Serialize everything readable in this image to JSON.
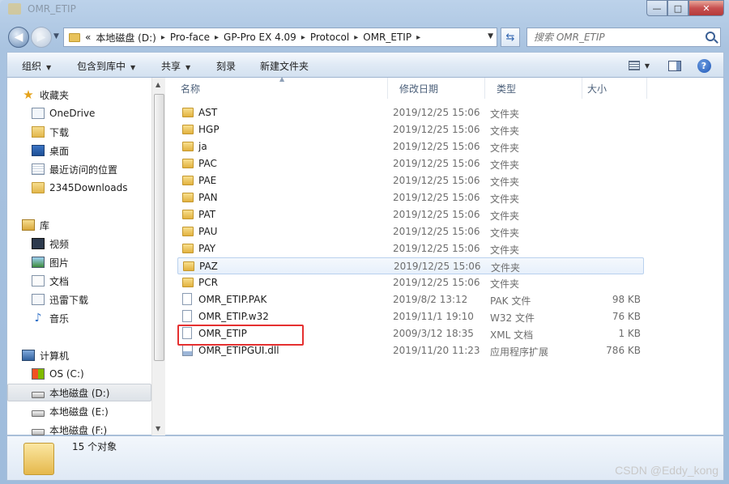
{
  "window": {
    "title": "OMR_ETIP",
    "buttons": {
      "minimize": "—",
      "maximize": "□",
      "close": "✕"
    }
  },
  "address": {
    "prefix": "«",
    "crumbs": [
      "本地磁盘 (D:)",
      "Pro-face",
      "GP-Pro EX 4.09",
      "Protocol",
      "OMR_ETIP"
    ],
    "separator": "▸"
  },
  "search": {
    "placeholder": "搜索 OMR_ETIP"
  },
  "toolbar": {
    "organize": "组织",
    "include_in_library": "包含到库中",
    "share": "共享",
    "burn": "刻录",
    "new_folder": "新建文件夹"
  },
  "navpane": {
    "favorites": {
      "header": "收藏夹",
      "items": [
        "OneDrive",
        "下载",
        "桌面",
        "最近访问的位置",
        "2345Downloads"
      ]
    },
    "libraries": {
      "header": "库",
      "items": [
        "视频",
        "图片",
        "文档",
        "迅雷下载",
        "音乐"
      ]
    },
    "computer": {
      "header": "计算机",
      "items": [
        "OS (C:)",
        "本地磁盘 (D:)",
        "本地磁盘 (E:)",
        "本地磁盘 (F:)"
      ],
      "selected": "本地磁盘 (D:)"
    }
  },
  "columns": {
    "name": "名称",
    "modified": "修改日期",
    "type": "类型",
    "size": "大小"
  },
  "files": [
    {
      "name": "AST",
      "modified": "2019/12/25 15:06",
      "type": "文件夹",
      "size": "",
      "kind": "folder"
    },
    {
      "name": "HGP",
      "modified": "2019/12/25 15:06",
      "type": "文件夹",
      "size": "",
      "kind": "folder"
    },
    {
      "name": "ja",
      "modified": "2019/12/25 15:06",
      "type": "文件夹",
      "size": "",
      "kind": "folder"
    },
    {
      "name": "PAC",
      "modified": "2019/12/25 15:06",
      "type": "文件夹",
      "size": "",
      "kind": "folder"
    },
    {
      "name": "PAE",
      "modified": "2019/12/25 15:06",
      "type": "文件夹",
      "size": "",
      "kind": "folder"
    },
    {
      "name": "PAN",
      "modified": "2019/12/25 15:06",
      "type": "文件夹",
      "size": "",
      "kind": "folder"
    },
    {
      "name": "PAT",
      "modified": "2019/12/25 15:06",
      "type": "文件夹",
      "size": "",
      "kind": "folder"
    },
    {
      "name": "PAU",
      "modified": "2019/12/25 15:06",
      "type": "文件夹",
      "size": "",
      "kind": "folder"
    },
    {
      "name": "PAY",
      "modified": "2019/12/25 15:06",
      "type": "文件夹",
      "size": "",
      "kind": "folder"
    },
    {
      "name": "PAZ",
      "modified": "2019/12/25 15:06",
      "type": "文件夹",
      "size": "",
      "kind": "folder"
    },
    {
      "name": "PCR",
      "modified": "2019/12/25 15:06",
      "type": "文件夹",
      "size": "",
      "kind": "folder"
    },
    {
      "name": "OMR_ETIP.PAK",
      "modified": "2019/8/2 13:12",
      "type": "PAK 文件",
      "size": "98 KB",
      "kind": "file"
    },
    {
      "name": "OMR_ETIP.w32",
      "modified": "2019/11/1 19:10",
      "type": "W32 文件",
      "size": "76 KB",
      "kind": "file"
    },
    {
      "name": "OMR_ETIP",
      "modified": "2009/3/12 18:35",
      "type": "XML 文档",
      "size": "1 KB",
      "kind": "file"
    },
    {
      "name": "OMR_ETIPGUI.dll",
      "modified": "2019/11/20 11:23",
      "type": "应用程序扩展",
      "size": "786 KB",
      "kind": "dll"
    }
  ],
  "hovered_row": "PAZ",
  "highlighted_row": "OMR_ETIP",
  "details": {
    "item_count": "15 个对象"
  },
  "watermark": "CSDN @Eddy_kong"
}
